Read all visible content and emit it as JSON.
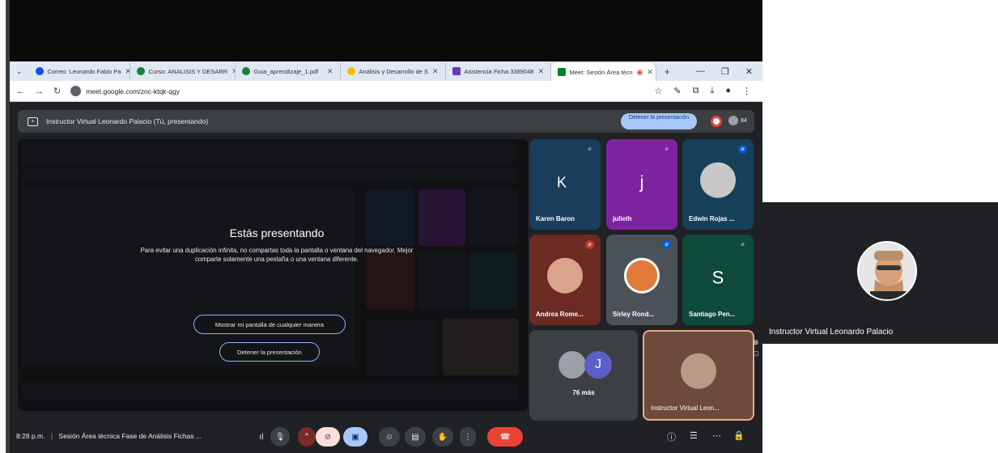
{
  "browser": {
    "tabs": [
      {
        "label": "Correo: Leonardo Fabio Pa",
        "fav_color": "#0b57d0",
        "active": false
      },
      {
        "label": "Curso: ANALISIS Y DESARR",
        "fav_color": "#188038",
        "active": false
      },
      {
        "label": "Guia_aprendizaje_1.pdf",
        "fav_color": "#188038",
        "active": false
      },
      {
        "label": "Análisis y Desarrollo de S",
        "fav_color": "#fbbc04",
        "active": false
      },
      {
        "label": "Asistencia Ficha 3389048",
        "fav_color": "#673ab7",
        "active": false
      },
      {
        "label": "Meet: Sesión Área técn",
        "fav_color": "#00832d",
        "active": true
      }
    ],
    "url": "meet.google.com/znc-ktqk-qgy"
  },
  "present_bar": {
    "title": "Instructor Virtual Leonardo Palacio (Tú, presentando)",
    "stop_button": "Detener la presentación",
    "participant_count": "84"
  },
  "presentation": {
    "heading": "Estás presentando",
    "body": "Para evitar una duplicación infinita, no compartas toda la pantalla o ventana del navegador. Mejor comparte solamente una pestaña o una ventana diferente.",
    "show_button": "Mostrar mi pantalla de cualquier manera",
    "stop_button": "Detener la presentación"
  },
  "tiles": [
    {
      "name": "Karen Baron",
      "letter": "K",
      "bg": "#1a3d5c",
      "muted": true
    },
    {
      "name": "julieth",
      "letter": "j",
      "bg": "#7e22a0",
      "muted": true
    },
    {
      "name": "Edwin Rojas ...",
      "letter": "",
      "bg": "#16405a",
      "muted": true
    },
    {
      "name": "Andrea Rome...",
      "letter": "",
      "bg": "#6b2a22",
      "muted": true
    },
    {
      "name": "Sirley Rond...",
      "letter": "",
      "bg": "#4a5257",
      "muted": true
    },
    {
      "name": "Santiago Pen...",
      "letter": "S",
      "bg": "#0e4a3c",
      "muted": true
    }
  ],
  "more": {
    "count_label": "76 más",
    "letter": "J"
  },
  "self_tile": {
    "name": "Instructor Virtual Leon..."
  },
  "bottom_bar": {
    "time": "8:28 p.m.",
    "meeting_name": "Sesión Área técnica Fase de Análisis Fichas ..."
  },
  "speaker": {
    "name": "Instructor Virtual Leonardo Palacio"
  },
  "colors": {
    "accent": "#a8c7fa",
    "end_call": "#ea4335",
    "meet_bg": "#202124"
  },
  "icons": [
    "arrow-left-icon",
    "arrow-right-icon",
    "reload-icon",
    "star-icon",
    "download-icon",
    "mic-off-icon",
    "camera-off-icon",
    "present-icon",
    "emoji-icon",
    "captions-icon",
    "hand-icon",
    "more-icon",
    "end-call-icon",
    "info-icon",
    "chat-icon",
    "activities-icon",
    "lock-icon"
  ]
}
